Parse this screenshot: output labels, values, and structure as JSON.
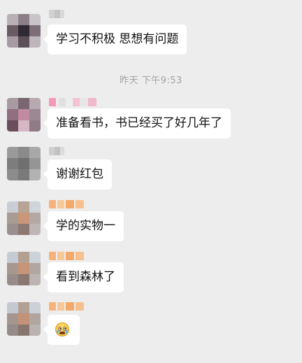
{
  "chat": {
    "timestamp": "昨天 下午9:53",
    "messages": [
      {
        "text": "学习不积极 思想有问题"
      },
      {
        "text": "准备看书，书已经买了好几年了"
      },
      {
        "text": "谢谢红包"
      },
      {
        "text": "学的实物一"
      },
      {
        "text": "看到森林了"
      },
      {
        "text": "",
        "emoji": "crying-face-icon"
      }
    ]
  },
  "colors": {
    "background": "#ededed",
    "bubble": "#ffffff",
    "timestamp_text": "#a3a3a3",
    "message_text": "#111111"
  }
}
